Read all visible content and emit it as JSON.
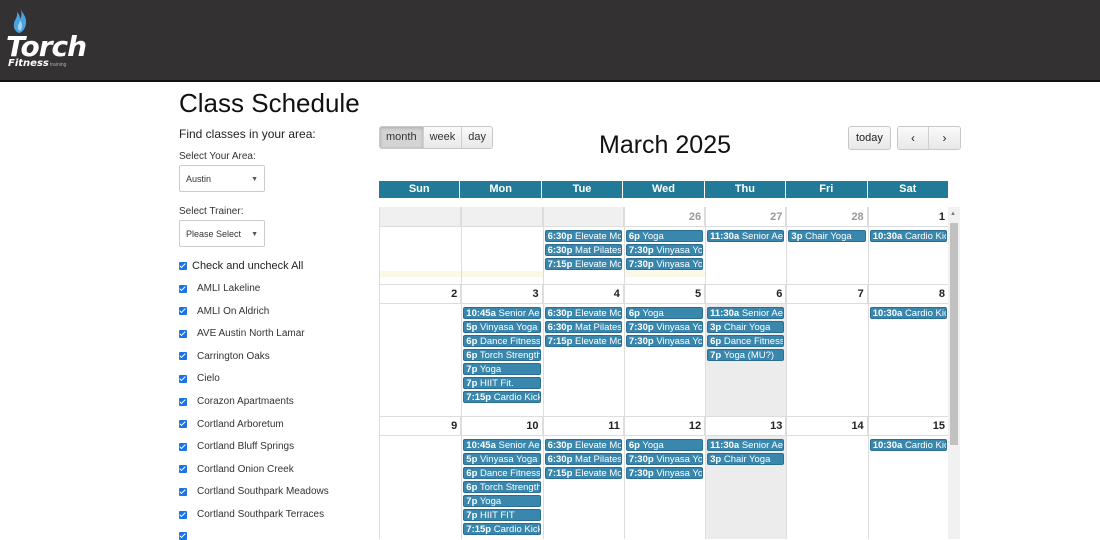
{
  "header": {
    "brand": "Torch",
    "brand_sub": "Fitness",
    "brand_tiny": "training"
  },
  "page": {
    "title": "Class Schedule"
  },
  "sidebar": {
    "find_label": "Find classes in your area:",
    "area_label": "Select Your Area:",
    "area_value": "Austin",
    "trainer_label": "Select Trainer:",
    "trainer_value": "Please Select",
    "check_all_label": "Check and uncheck All",
    "locations": [
      "AMLI Lakeline",
      "AMLI On Aldrich",
      "AVE Austin North Lamar",
      "Carrington Oaks",
      "Cielo",
      "Corazon Apartmaents",
      "Cortland Arboretum",
      "Cortland Bluff Springs",
      "Cortland Onion Creek",
      "Cortland Southpark Meadows",
      "Cortland Southpark Terraces"
    ]
  },
  "toolbar": {
    "views": [
      "month",
      "week",
      "day"
    ],
    "active_view": "month",
    "today_label": "today",
    "prev_icon": "chevron-left-icon",
    "next_icon": "chevron-right-icon"
  },
  "calendar": {
    "month_title": "March 2025",
    "weekdays": [
      "Sun",
      "Mon",
      "Tue",
      "Wed",
      "Thu",
      "Fri",
      "Sat"
    ],
    "weeks": [
      {
        "days": [
          "",
          "",
          "",
          "26",
          "27",
          "28",
          "1"
        ],
        "events": [
          [],
          [],
          [
            [
              "6:30p",
              "Elevate Movement"
            ],
            [
              "6:30p",
              "Mat Pilates"
            ],
            [
              "7:15p",
              "Elevate Movement"
            ]
          ],
          [
            [
              "6p",
              "Yoga"
            ],
            [
              "7:30p",
              "Vinyasa Yoga"
            ],
            [
              "7:30p",
              "Vinyasa Yoga"
            ]
          ],
          [
            [
              "11:30a",
              "Senior Aerobics"
            ]
          ],
          [
            [
              "3p",
              "Chair Yoga"
            ]
          ],
          [
            [
              "10:30a",
              "Cardio Kickboxing"
            ]
          ]
        ]
      },
      {
        "days": [
          "2",
          "3",
          "4",
          "5",
          "6",
          "7",
          "8"
        ],
        "events": [
          [],
          [
            [
              "10:45a",
              "Senior Aerobics"
            ],
            [
              "5p",
              "Vinyasa Yoga"
            ],
            [
              "6p",
              "Dance Fitness"
            ],
            [
              "6p",
              "Torch Strength"
            ],
            [
              "7p",
              "Yoga"
            ],
            [
              "7p",
              "HIIT Fit."
            ],
            [
              "7:15p",
              "Cardio Kickboxing"
            ]
          ],
          [
            [
              "6:30p",
              "Elevate Movement"
            ],
            [
              "6:30p",
              "Mat Pilates"
            ],
            [
              "7:15p",
              "Elevate Movement"
            ]
          ],
          [
            [
              "6p",
              "Yoga"
            ],
            [
              "7:30p",
              "Vinyasa Yoga"
            ],
            [
              "7:30p",
              "Vinyasa Yoga"
            ]
          ],
          [
            [
              "11:30a",
              "Senior Aerobics"
            ],
            [
              "3p",
              "Chair Yoga"
            ],
            [
              "6p",
              "Dance Fitness"
            ],
            [
              "7p",
              "Yoga (MU?)"
            ]
          ],
          [],
          [
            [
              "10:30a",
              "Cardio Kickboxing"
            ]
          ]
        ]
      },
      {
        "days": [
          "9",
          "10",
          "11",
          "12",
          "13",
          "14",
          "15"
        ],
        "events": [
          [],
          [
            [
              "10:45a",
              "Senior Aerobics"
            ],
            [
              "5p",
              "Vinyasa Yoga"
            ],
            [
              "6p",
              "Dance Fitness"
            ],
            [
              "6p",
              "Torch Strength"
            ],
            [
              "7p",
              "Yoga"
            ],
            [
              "7p",
              "HIIT FIT"
            ],
            [
              "7:15p",
              "Cardio Kickboxing"
            ]
          ],
          [
            [
              "6:30p",
              "Elevate Movement"
            ],
            [
              "6:30p",
              "Mat Pilates"
            ],
            [
              "7:15p",
              "Elevate Movement"
            ]
          ],
          [
            [
              "6p",
              "Yoga"
            ],
            [
              "7:30p",
              "Vinyasa Yoga"
            ],
            [
              "7:30p",
              "Vinyasa Yoga"
            ]
          ],
          [
            [
              "11:30a",
              "Senior Aerobics"
            ],
            [
              "3p",
              "Chair Yoga"
            ]
          ],
          [],
          [
            [
              "10:30a",
              "Cardio Kickboxing"
            ]
          ]
        ]
      }
    ]
  },
  "colors": {
    "header_bg": "#333132",
    "weekday_bg": "#217a98",
    "event_bg": "#3a87ad",
    "checkbox": "#1a73e8"
  }
}
